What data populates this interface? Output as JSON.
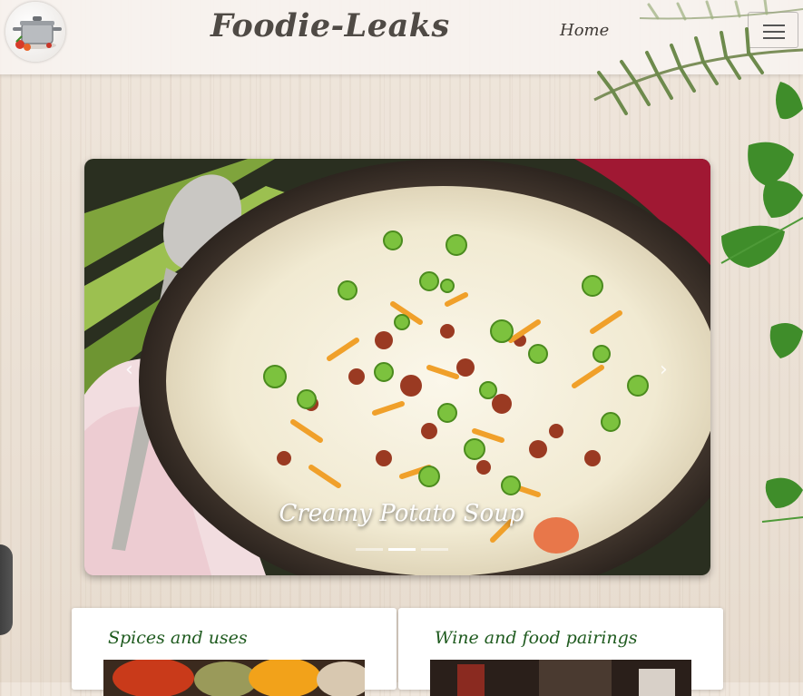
{
  "header": {
    "brand": "Foodie-Leaks",
    "nav_home": "Home",
    "logo_icon": "cooking-pot-icon",
    "menu_icon": "hamburger-menu-icon"
  },
  "hero": {
    "caption": "Creamy Potato Soup",
    "slides_count": 3,
    "active_slide": 1
  },
  "cards": [
    {
      "title": "Spices and uses"
    },
    {
      "title": "Wine and food pairings"
    }
  ],
  "colors": {
    "card_title": "#1e5a1e",
    "brand_text": "#4f4a45",
    "background": "#efe6dc"
  }
}
